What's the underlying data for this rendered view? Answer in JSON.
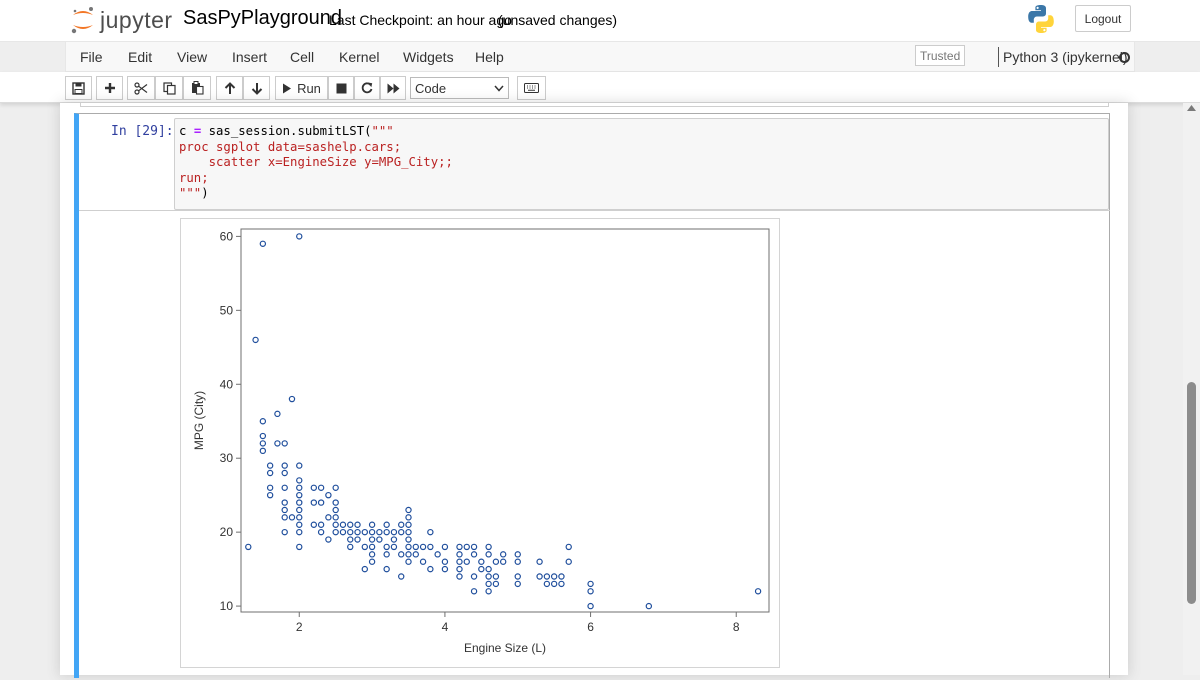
{
  "header": {
    "logo_text": "jupyter",
    "notebook_name": "SasPyPlayground",
    "checkpoint": "Last Checkpoint: an hour ago",
    "autosave_status": "(unsaved changes)",
    "logout_label": "Logout"
  },
  "menubar": {
    "items": [
      "File",
      "Edit",
      "View",
      "Insert",
      "Cell",
      "Kernel",
      "Widgets",
      "Help"
    ],
    "trusted_label": "Trusted",
    "kernel_name": "Python 3 (ipykernel)"
  },
  "toolbar": {
    "save_icon": "save-icon",
    "add_icon": "plus-icon",
    "cut_icon": "scissors-icon",
    "copy_icon": "copy-icon",
    "paste_icon": "paste-icon",
    "move_up_icon": "arrow-up-icon",
    "move_down_icon": "arrow-down-icon",
    "run_label": "Run",
    "interrupt_icon": "stop-icon",
    "restart_icon": "restart-icon",
    "restart_run_icon": "fast-forward-icon",
    "cell_type": "Code",
    "command_palette_icon": "keyboard-icon"
  },
  "cell": {
    "prompt": "In [29]:",
    "code_lines": [
      "c = sas_session.submitLST(\"\"\"",
      "proc sgplot data=sashelp.cars;",
      "    scatter x=EngineSize y=MPG_City;;",
      "run;",
      "\"\"\")"
    ]
  },
  "colors": {
    "cell_selected_border": "#42a5f5",
    "prompt": "#303f9f",
    "marker": "#1f4e9c"
  },
  "chart_data": {
    "type": "scatter",
    "title": "",
    "xlabel": "Engine Size (L)",
    "ylabel": "MPG (City)",
    "xlim": [
      1.2,
      8.45
    ],
    "ylim": [
      9.2,
      61
    ],
    "xticks": [
      2,
      4,
      6,
      8
    ],
    "yticks": [
      10,
      20,
      30,
      40,
      50,
      60
    ],
    "grid": false,
    "marker": "open-circle",
    "points": [
      [
        1.3,
        18
      ],
      [
        1.4,
        46
      ],
      [
        1.5,
        59
      ],
      [
        1.5,
        35
      ],
      [
        1.5,
        33
      ],
      [
        1.5,
        32
      ],
      [
        1.5,
        31
      ],
      [
        1.6,
        29
      ],
      [
        1.6,
        28
      ],
      [
        1.6,
        26
      ],
      [
        1.6,
        25
      ],
      [
        1.7,
        36
      ],
      [
        1.7,
        32
      ],
      [
        1.8,
        32
      ],
      [
        1.8,
        29
      ],
      [
        1.8,
        28
      ],
      [
        1.8,
        26
      ],
      [
        1.8,
        24
      ],
      [
        1.8,
        23
      ],
      [
        1.8,
        22
      ],
      [
        1.8,
        20
      ],
      [
        1.9,
        38
      ],
      [
        1.9,
        22
      ],
      [
        2.0,
        60
      ],
      [
        2.0,
        29
      ],
      [
        2.0,
        27
      ],
      [
        2.0,
        26
      ],
      [
        2.0,
        25
      ],
      [
        2.0,
        24
      ],
      [
        2.0,
        23
      ],
      [
        2.0,
        22
      ],
      [
        2.0,
        21
      ],
      [
        2.0,
        20
      ],
      [
        2.0,
        18
      ],
      [
        2.2,
        26
      ],
      [
        2.2,
        24
      ],
      [
        2.2,
        21
      ],
      [
        2.3,
        26
      ],
      [
        2.3,
        24
      ],
      [
        2.3,
        21
      ],
      [
        2.3,
        20
      ],
      [
        2.4,
        25
      ],
      [
        2.4,
        22
      ],
      [
        2.4,
        19
      ],
      [
        2.5,
        26
      ],
      [
        2.5,
        24
      ],
      [
        2.5,
        23
      ],
      [
        2.5,
        22
      ],
      [
        2.5,
        21
      ],
      [
        2.5,
        20
      ],
      [
        2.6,
        21
      ],
      [
        2.6,
        20
      ],
      [
        2.7,
        21
      ],
      [
        2.7,
        20
      ],
      [
        2.7,
        19
      ],
      [
        2.7,
        18
      ],
      [
        2.8,
        21
      ],
      [
        2.8,
        20
      ],
      [
        2.8,
        19
      ],
      [
        2.9,
        20
      ],
      [
        2.9,
        18
      ],
      [
        2.9,
        15
      ],
      [
        3.0,
        21
      ],
      [
        3.0,
        20
      ],
      [
        3.0,
        19
      ],
      [
        3.0,
        18
      ],
      [
        3.0,
        17
      ],
      [
        3.0,
        16
      ],
      [
        3.1,
        20
      ],
      [
        3.1,
        19
      ],
      [
        3.2,
        21
      ],
      [
        3.2,
        20
      ],
      [
        3.2,
        18
      ],
      [
        3.2,
        17
      ],
      [
        3.2,
        15
      ],
      [
        3.3,
        20
      ],
      [
        3.3,
        19
      ],
      [
        3.3,
        18
      ],
      [
        3.4,
        21
      ],
      [
        3.4,
        20
      ],
      [
        3.4,
        17
      ],
      [
        3.4,
        14
      ],
      [
        3.5,
        23
      ],
      [
        3.5,
        22
      ],
      [
        3.5,
        21
      ],
      [
        3.5,
        20
      ],
      [
        3.5,
        19
      ],
      [
        3.5,
        18
      ],
      [
        3.5,
        17
      ],
      [
        3.5,
        16
      ],
      [
        3.6,
        18
      ],
      [
        3.6,
        17
      ],
      [
        3.7,
        18
      ],
      [
        3.7,
        16
      ],
      [
        3.8,
        20
      ],
      [
        3.8,
        18
      ],
      [
        3.8,
        15
      ],
      [
        3.9,
        17
      ],
      [
        4.0,
        18
      ],
      [
        4.0,
        16
      ],
      [
        4.0,
        15
      ],
      [
        4.2,
        18
      ],
      [
        4.2,
        17
      ],
      [
        4.2,
        16
      ],
      [
        4.2,
        15
      ],
      [
        4.2,
        14
      ],
      [
        4.3,
        18
      ],
      [
        4.3,
        16
      ],
      [
        4.4,
        18
      ],
      [
        4.4,
        17
      ],
      [
        4.4,
        14
      ],
      [
        4.4,
        12
      ],
      [
        4.5,
        16
      ],
      [
        4.5,
        15
      ],
      [
        4.6,
        18
      ],
      [
        4.6,
        17
      ],
      [
        4.6,
        15
      ],
      [
        4.6,
        14
      ],
      [
        4.6,
        13
      ],
      [
        4.6,
        12
      ],
      [
        4.7,
        16
      ],
      [
        4.7,
        14
      ],
      [
        4.7,
        13
      ],
      [
        4.8,
        17
      ],
      [
        4.8,
        16
      ],
      [
        5.0,
        17
      ],
      [
        5.0,
        16
      ],
      [
        5.0,
        14
      ],
      [
        5.0,
        13
      ],
      [
        5.3,
        16
      ],
      [
        5.3,
        14
      ],
      [
        5.4,
        14
      ],
      [
        5.4,
        13
      ],
      [
        5.5,
        14
      ],
      [
        5.5,
        13
      ],
      [
        5.6,
        14
      ],
      [
        5.6,
        13
      ],
      [
        5.7,
        18
      ],
      [
        5.7,
        16
      ],
      [
        6.0,
        13
      ],
      [
        6.0,
        12
      ],
      [
        6.0,
        10
      ],
      [
        6.8,
        10
      ],
      [
        8.3,
        12
      ]
    ]
  }
}
